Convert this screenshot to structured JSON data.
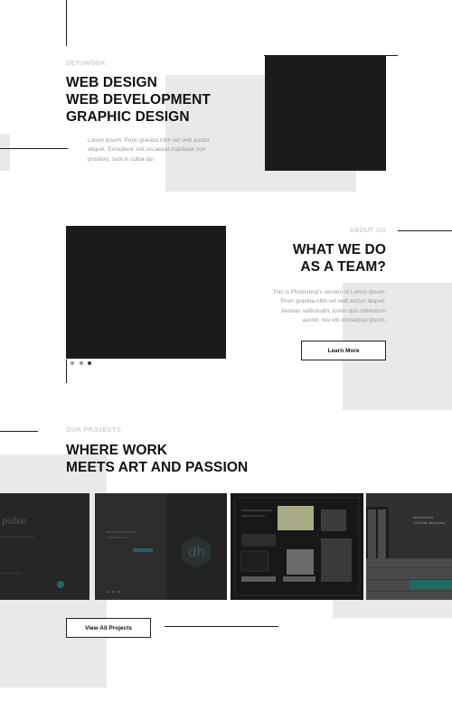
{
  "hero": {
    "eyebrow": "DEVSNOOK",
    "services": [
      "WEB DESIGN",
      "WEB DEVELOPMENT",
      "GRAPHIC DESIGN"
    ],
    "description_lines": [
      "Lorem ipsum. Proin gravida nibh vel velit auctor",
      "aliquet. Excepteur sint occaecat cupidatat non",
      "proident, sunt in culpa qui"
    ]
  },
  "about": {
    "eyebrow": "ABOUT US",
    "title_lines": [
      "WHAT WE DO",
      "AS A TEAM?"
    ],
    "description_lines": [
      "This is Photoshop's version  of Lorem Ipsum.",
      "Proin gravida nibh vel velit auctor aliquet.",
      "Aenean sollicitudin, lorem quis bibendum",
      "auctor, nisi elit consequat ipsum,"
    ],
    "button_label": "Learn More",
    "slider": {
      "dot_count": 3,
      "active_index": 2
    }
  },
  "projects": {
    "eyebrow": "OUR PROJECTS",
    "title_lines": [
      "WHERE WORK",
      "MEETS ART AND PASSION"
    ],
    "button_label": "View All Projects",
    "thumb_texts": {
      "t4_title": "interior/build",
      "t4_subtitle": "Let's talk about your"
    }
  },
  "colors": {
    "accent_dark": "#1b1b1b",
    "light_grey": "#e9e9e9",
    "teal_accent": "#1e6b63"
  }
}
